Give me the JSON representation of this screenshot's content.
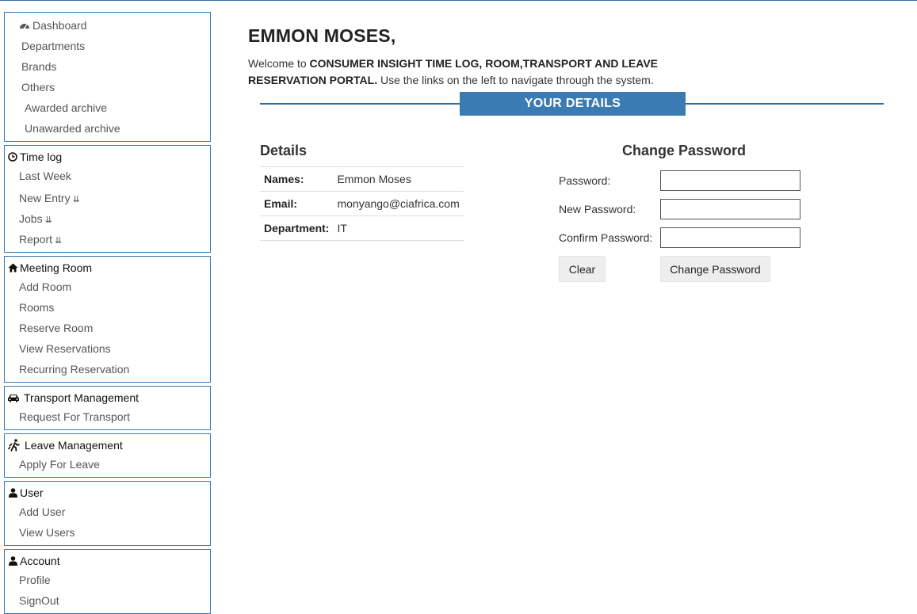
{
  "sidebar": {
    "dashboard_group": {
      "dashboard": "Dashboard",
      "departments": "Departments",
      "brands": "Brands",
      "others": "Others",
      "awarded_archive": "Awarded archive",
      "unawarded_archive": "Unawarded archive"
    },
    "time_log": {
      "title": "Time log",
      "items": [
        "Last Week",
        "New Entry",
        "Jobs",
        "Report"
      ],
      "dropdown_glyph": "»"
    },
    "meeting_room": {
      "title": "Meeting Room",
      "items": [
        "Add Room",
        "Rooms",
        "Reserve Room",
        "View Reservations",
        "Recurring Reservation"
      ]
    },
    "transport": {
      "title": "Transport Management",
      "items": [
        "Request For Transport"
      ]
    },
    "leave": {
      "title": "Leave Management",
      "items": [
        "Apply For Leave"
      ]
    },
    "user": {
      "title": "User",
      "items": [
        "Add User",
        "View Users"
      ]
    },
    "account": {
      "title": "Account",
      "items": [
        "Profile",
        "SignOut"
      ]
    }
  },
  "main": {
    "username": "EMMON MOSES,",
    "welcome_prefix": "Welcome to ",
    "portal_name": "CONSUMER INSIGHT TIME LOG, ROOM,TRANSPORT AND LEAVE RESERVATION PORTAL.",
    "welcome_suffix": " Use the links on the left to navigate through the system.",
    "section_title": "YOUR DETAILS",
    "details": {
      "title": "Details",
      "rows": [
        {
          "label": "Names:",
          "value": "Emmon Moses"
        },
        {
          "label": "Email:",
          "value": "monyango@ciafrica.com"
        },
        {
          "label": "Department:",
          "value": "IT"
        }
      ]
    },
    "change_password": {
      "title": "Change Password",
      "password_label": "Password:",
      "new_password_label": "New Password:",
      "confirm_password_label": "Confirm Password:",
      "password_value": "",
      "new_password_value": "",
      "confirm_password_value": "",
      "clear_label": "Clear",
      "submit_label": "Change Password"
    }
  },
  "colors": {
    "accent": "#3a7bb4",
    "border": "#3a7bb4"
  }
}
